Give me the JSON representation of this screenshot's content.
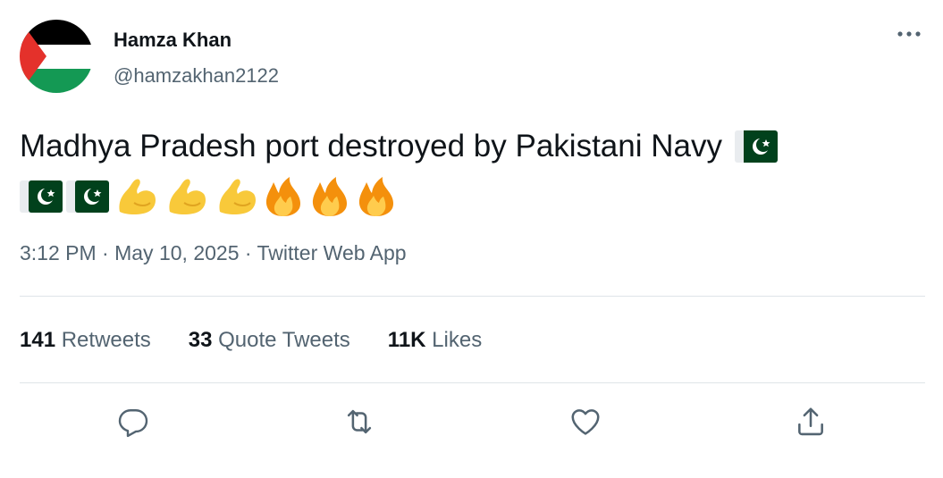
{
  "author": {
    "display_name": "Hamza Khan",
    "handle": "@hamzakhan2122",
    "avatar": "palestine-flag-avatar"
  },
  "header": {
    "more_icon": "more-horizontal-icon"
  },
  "tweet": {
    "text": "Madhya Pradesh port destroyed by Pakistani Navy",
    "emojis_line1": [
      "pakistan-flag-emoji"
    ],
    "emojis_line2": [
      "pakistan-flag-emoji",
      "pakistan-flag-emoji",
      "flexed-biceps-emoji",
      "flexed-biceps-emoji",
      "flexed-biceps-emoji",
      "fire-emoji",
      "fire-emoji",
      "fire-emoji"
    ]
  },
  "meta": {
    "time": "3:12 PM",
    "separator": "·",
    "date": "May 10, 2025",
    "source": "Twitter Web App"
  },
  "stats": {
    "retweets_count": "141",
    "retweets_label": "Retweets",
    "quotes_count": "33",
    "quotes_label": "Quote Tweets",
    "likes_count": "11K",
    "likes_label": "Likes"
  },
  "actions": [
    "reply-icon",
    "retweet-icon",
    "like-icon",
    "share-icon"
  ],
  "colors": {
    "text": "#0f1419",
    "secondary": "#536471",
    "divider": "#dfe4e8"
  }
}
